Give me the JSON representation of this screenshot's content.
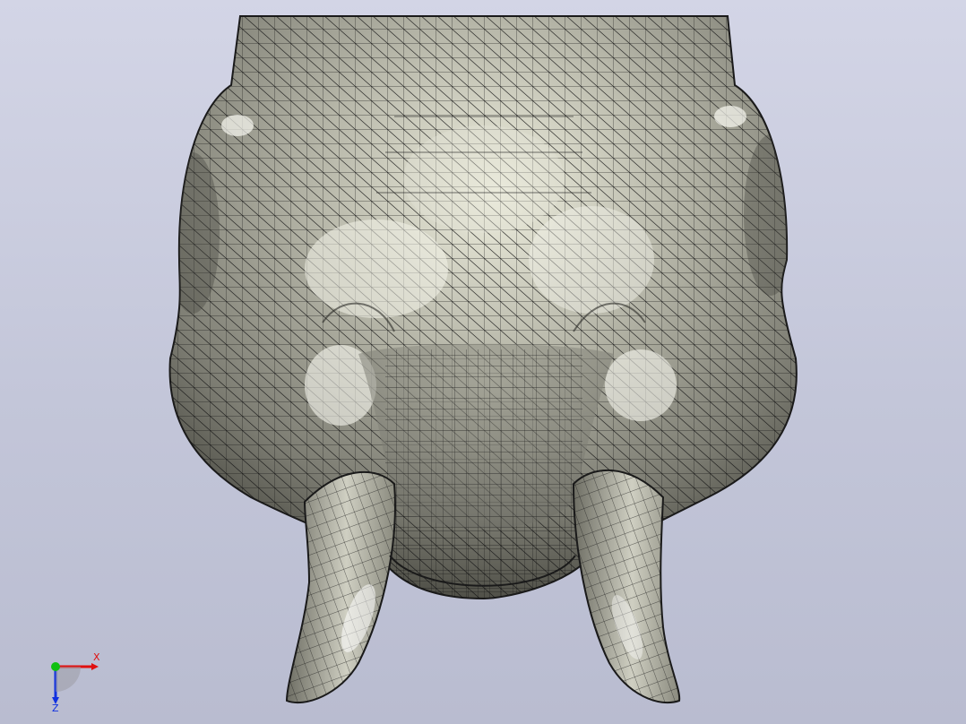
{
  "model": {
    "name": "elephant-head-mesh",
    "display_mode": "shaded-with-edges",
    "mesh_color": "#a8a89c",
    "edge_color": "#1a1a1a",
    "highlight_color": "#f4f4ea"
  },
  "triad": {
    "x_label": "X",
    "z_label": "Z",
    "colors": {
      "x": "#e01010",
      "y": "#10c010",
      "z": "#1030e0"
    }
  }
}
